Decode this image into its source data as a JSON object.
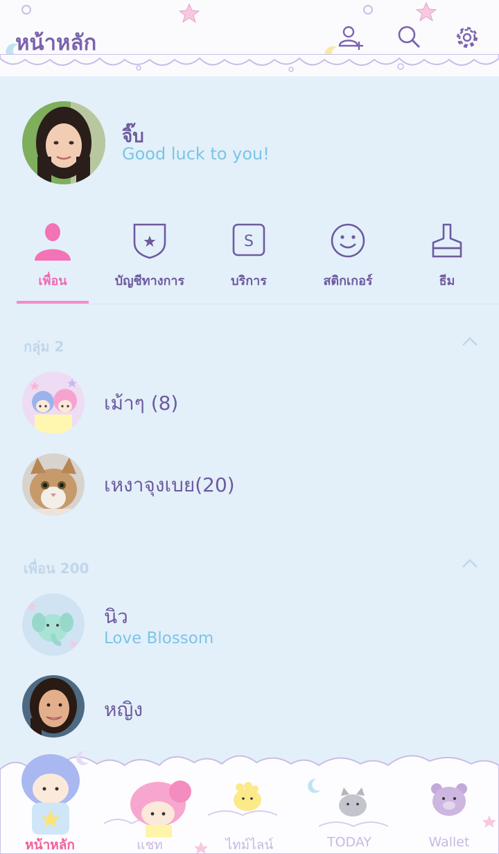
{
  "header": {
    "title": "หน้าหลัก",
    "icons": [
      "add-friend-icon",
      "search-icon",
      "settings-icon"
    ]
  },
  "profile": {
    "name": "จิ๊บ",
    "status": "Good luck to you!"
  },
  "tabs": [
    {
      "label": "เพื่อน",
      "icon": "person-icon",
      "active": true
    },
    {
      "label": "บัญชีทางการ",
      "icon": "official-shield-icon"
    },
    {
      "label": "บริการ",
      "icon": "service-s-icon"
    },
    {
      "label": "สติกเกอร์",
      "icon": "smiley-icon"
    },
    {
      "label": "ธีม",
      "icon": "theme-brush-icon"
    }
  ],
  "groups": {
    "header": "กลุ่ม 2",
    "items": [
      {
        "name": "เม้าๆ (8)"
      },
      {
        "name": "เหงาจุงเบย(20)"
      }
    ]
  },
  "friends": {
    "header": "เพื่อน 200",
    "items": [
      {
        "name": "นิว",
        "status": "Love Blossom"
      },
      {
        "name": "หญิง",
        "status": ""
      }
    ]
  },
  "bottom_nav": [
    {
      "label": "หน้าหลัก",
      "active": true
    },
    {
      "label": "แชท"
    },
    {
      "label": "ไทม์ไลน์"
    },
    {
      "label": "TODAY"
    },
    {
      "label": "Wallet"
    }
  ],
  "colors": {
    "background": "#e3f0fa",
    "primary_text": "#6e5a9e",
    "accent_pink": "#f06ab4",
    "status_blue": "#7cc4e6"
  }
}
